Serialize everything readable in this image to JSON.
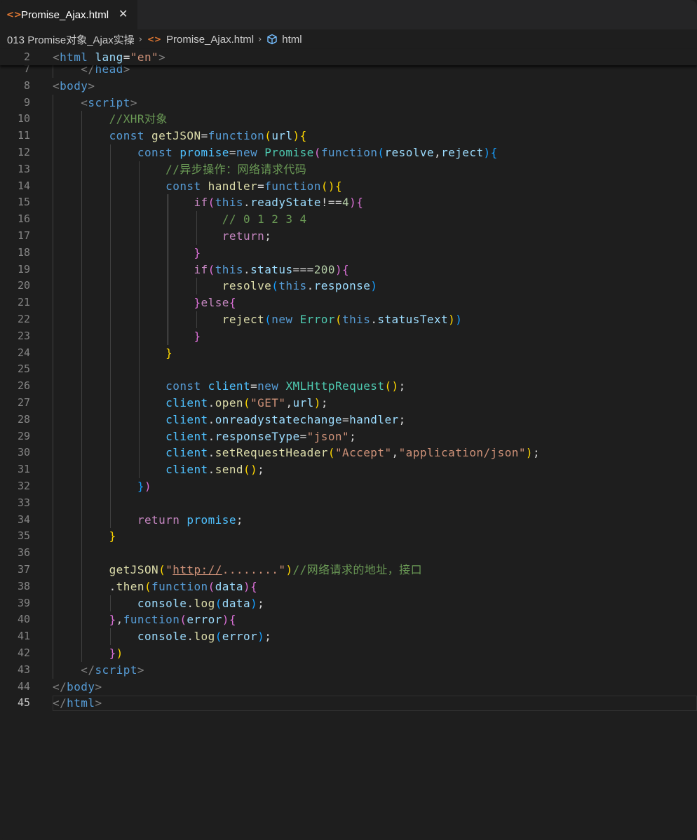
{
  "tab": {
    "icon": "html-code-icon",
    "label": "Promise_Ajax.html",
    "close": "✕"
  },
  "breadcrumb": {
    "folder": "013 Promise对象_Ajax实操",
    "file": "Promise_Ajax.html",
    "symbol": "html",
    "separator": "›"
  },
  "editor": {
    "active_line": "45",
    "sticky_line": {
      "number": "2",
      "tokens": [
        [
          "t-punc",
          "<"
        ],
        [
          "t-tag",
          "html"
        ],
        [
          "t-op",
          " "
        ],
        [
          "t-attr",
          "lang"
        ],
        [
          "t-op",
          "="
        ],
        [
          "t-str",
          "\"en\""
        ],
        [
          "t-punc",
          ">"
        ]
      ]
    },
    "lines": [
      {
        "n": "7",
        "tokens": [
          [
            "t-op",
            "    "
          ],
          [
            "t-punc",
            "</"
          ],
          [
            "t-tag",
            "head"
          ],
          [
            "t-punc",
            ">"
          ]
        ]
      },
      {
        "n": "8",
        "tokens": [
          [
            "t-punc",
            "<"
          ],
          [
            "t-tag",
            "body"
          ],
          [
            "t-punc",
            ">"
          ]
        ]
      },
      {
        "n": "9",
        "tokens": [
          [
            "t-op",
            "    "
          ],
          [
            "t-punc",
            "<"
          ],
          [
            "t-tag",
            "script"
          ],
          [
            "t-punc",
            ">"
          ]
        ]
      },
      {
        "n": "10",
        "tokens": [
          [
            "t-op",
            "        "
          ],
          [
            "t-com",
            "//XHR对象"
          ]
        ]
      },
      {
        "n": "11",
        "tokens": [
          [
            "t-op",
            "        "
          ],
          [
            "t-kw",
            "const"
          ],
          [
            "t-op",
            " "
          ],
          [
            "t-fn",
            "getJSON"
          ],
          [
            "t-op",
            "="
          ],
          [
            "t-kw",
            "function"
          ],
          [
            "b1",
            "("
          ],
          [
            "t-var",
            "url"
          ],
          [
            "b1",
            ")"
          ],
          [
            "b1",
            "{"
          ]
        ]
      },
      {
        "n": "12",
        "tokens": [
          [
            "t-op",
            "            "
          ],
          [
            "t-kw",
            "const"
          ],
          [
            "t-op",
            " "
          ],
          [
            "t-const",
            "promise"
          ],
          [
            "t-op",
            "="
          ],
          [
            "t-kw",
            "new"
          ],
          [
            "t-op",
            " "
          ],
          [
            "t-cls",
            "Promise"
          ],
          [
            "b2",
            "("
          ],
          [
            "t-kw",
            "function"
          ],
          [
            "b3",
            "("
          ],
          [
            "t-var",
            "resolve"
          ],
          [
            "t-op",
            ","
          ],
          [
            "t-var",
            "reject"
          ],
          [
            "b3",
            ")"
          ],
          [
            "b3",
            "{"
          ]
        ]
      },
      {
        "n": "13",
        "tokens": [
          [
            "t-op",
            "                "
          ],
          [
            "t-com",
            "//异步操作：网络请求代码"
          ]
        ]
      },
      {
        "n": "14",
        "tokens": [
          [
            "t-op",
            "                "
          ],
          [
            "t-kw",
            "const"
          ],
          [
            "t-op",
            " "
          ],
          [
            "t-fn",
            "handler"
          ],
          [
            "t-op",
            "="
          ],
          [
            "t-kw",
            "function"
          ],
          [
            "b1",
            "("
          ],
          [
            "b1",
            ")"
          ],
          [
            "b1",
            "{"
          ]
        ]
      },
      {
        "n": "15",
        "tokens": [
          [
            "t-op",
            "                    "
          ],
          [
            "t-ctl",
            "if"
          ],
          [
            "b2",
            "("
          ],
          [
            "t-kw",
            "this"
          ],
          [
            "t-op",
            "."
          ],
          [
            "t-var",
            "readyState"
          ],
          [
            "t-op",
            "!=="
          ],
          [
            "t-num",
            "4"
          ],
          [
            "b2",
            ")"
          ],
          [
            "b2",
            "{"
          ]
        ]
      },
      {
        "n": "16",
        "tokens": [
          [
            "t-op",
            "                        "
          ],
          [
            "t-com",
            "// 0 1 2 3 4"
          ]
        ]
      },
      {
        "n": "17",
        "tokens": [
          [
            "t-op",
            "                        "
          ],
          [
            "t-ctl",
            "return"
          ],
          [
            "t-op",
            ";"
          ]
        ]
      },
      {
        "n": "18",
        "tokens": [
          [
            "t-op",
            "                    "
          ],
          [
            "b2",
            "}"
          ]
        ]
      },
      {
        "n": "19",
        "tokens": [
          [
            "t-op",
            "                    "
          ],
          [
            "t-ctl",
            "if"
          ],
          [
            "b2",
            "("
          ],
          [
            "t-kw",
            "this"
          ],
          [
            "t-op",
            "."
          ],
          [
            "t-var",
            "status"
          ],
          [
            "t-op",
            "==="
          ],
          [
            "t-num",
            "200"
          ],
          [
            "b2",
            ")"
          ],
          [
            "b2",
            "{"
          ]
        ]
      },
      {
        "n": "20",
        "tokens": [
          [
            "t-op",
            "                        "
          ],
          [
            "t-fn",
            "resolve"
          ],
          [
            "b3",
            "("
          ],
          [
            "t-kw",
            "this"
          ],
          [
            "t-op",
            "."
          ],
          [
            "t-var",
            "response"
          ],
          [
            "b3",
            ")"
          ]
        ]
      },
      {
        "n": "21",
        "tokens": [
          [
            "t-op",
            "                    "
          ],
          [
            "b2",
            "}"
          ],
          [
            "t-ctl",
            "else"
          ],
          [
            "b2",
            "{"
          ]
        ]
      },
      {
        "n": "22",
        "tokens": [
          [
            "t-op",
            "                        "
          ],
          [
            "t-fn",
            "reject"
          ],
          [
            "b3",
            "("
          ],
          [
            "t-kw",
            "new"
          ],
          [
            "t-op",
            " "
          ],
          [
            "t-cls",
            "Error"
          ],
          [
            "b1",
            "("
          ],
          [
            "t-kw",
            "this"
          ],
          [
            "t-op",
            "."
          ],
          [
            "t-var",
            "statusText"
          ],
          [
            "b1",
            ")"
          ],
          [
            "b3",
            ")"
          ]
        ]
      },
      {
        "n": "23",
        "tokens": [
          [
            "t-op",
            "                    "
          ],
          [
            "b2",
            "}"
          ]
        ]
      },
      {
        "n": "24",
        "tokens": [
          [
            "t-op",
            "                "
          ],
          [
            "b1",
            "}"
          ]
        ]
      },
      {
        "n": "25",
        "tokens": []
      },
      {
        "n": "26",
        "tokens": [
          [
            "t-op",
            "                "
          ],
          [
            "t-kw",
            "const"
          ],
          [
            "t-op",
            " "
          ],
          [
            "t-const",
            "client"
          ],
          [
            "t-op",
            "="
          ],
          [
            "t-kw",
            "new"
          ],
          [
            "t-op",
            " "
          ],
          [
            "t-cls",
            "XMLHttpRequest"
          ],
          [
            "b1",
            "("
          ],
          [
            "b1",
            ")"
          ],
          [
            "t-op",
            ";"
          ]
        ]
      },
      {
        "n": "27",
        "tokens": [
          [
            "t-op",
            "                "
          ],
          [
            "t-const",
            "client"
          ],
          [
            "t-op",
            "."
          ],
          [
            "t-fn",
            "open"
          ],
          [
            "b1",
            "("
          ],
          [
            "t-str",
            "\"GET\""
          ],
          [
            "t-op",
            ","
          ],
          [
            "t-var",
            "url"
          ],
          [
            "b1",
            ")"
          ],
          [
            "t-op",
            ";"
          ]
        ]
      },
      {
        "n": "28",
        "tokens": [
          [
            "t-op",
            "                "
          ],
          [
            "t-const",
            "client"
          ],
          [
            "t-op",
            "."
          ],
          [
            "t-var",
            "onreadystatechange"
          ],
          [
            "t-op",
            "="
          ],
          [
            "t-var",
            "handler"
          ],
          [
            "t-op",
            ";"
          ]
        ]
      },
      {
        "n": "29",
        "tokens": [
          [
            "t-op",
            "                "
          ],
          [
            "t-const",
            "client"
          ],
          [
            "t-op",
            "."
          ],
          [
            "t-var",
            "responseType"
          ],
          [
            "t-op",
            "="
          ],
          [
            "t-str",
            "\"json\""
          ],
          [
            "t-op",
            ";"
          ]
        ]
      },
      {
        "n": "30",
        "tokens": [
          [
            "t-op",
            "                "
          ],
          [
            "t-const",
            "client"
          ],
          [
            "t-op",
            "."
          ],
          [
            "t-fn",
            "setRequestHeader"
          ],
          [
            "b1",
            "("
          ],
          [
            "t-str",
            "\"Accept\""
          ],
          [
            "t-op",
            ","
          ],
          [
            "t-str",
            "\"application/json\""
          ],
          [
            "b1",
            ")"
          ],
          [
            "t-op",
            ";"
          ]
        ]
      },
      {
        "n": "31",
        "tokens": [
          [
            "t-op",
            "                "
          ],
          [
            "t-const",
            "client"
          ],
          [
            "t-op",
            "."
          ],
          [
            "t-fn",
            "send"
          ],
          [
            "b1",
            "("
          ],
          [
            "b1",
            ")"
          ],
          [
            "t-op",
            ";"
          ]
        ]
      },
      {
        "n": "32",
        "tokens": [
          [
            "t-op",
            "            "
          ],
          [
            "b3",
            "}"
          ],
          [
            "b2",
            ")"
          ]
        ]
      },
      {
        "n": "33",
        "tokens": []
      },
      {
        "n": "34",
        "tokens": [
          [
            "t-op",
            "            "
          ],
          [
            "t-ctl",
            "return"
          ],
          [
            "t-op",
            " "
          ],
          [
            "t-const",
            "promise"
          ],
          [
            "t-op",
            ";"
          ]
        ]
      },
      {
        "n": "35",
        "tokens": [
          [
            "t-op",
            "        "
          ],
          [
            "b1",
            "}"
          ]
        ]
      },
      {
        "n": "36",
        "tokens": []
      },
      {
        "n": "37",
        "tokens": [
          [
            "t-op",
            "        "
          ],
          [
            "t-fn",
            "getJSON"
          ],
          [
            "b1",
            "("
          ],
          [
            "t-str",
            "\""
          ],
          [
            "t-str t-link",
            "http://"
          ],
          [
            "t-str",
            "........\""
          ],
          [
            "b1",
            ")"
          ],
          [
            "t-com",
            "//网络请求的地址，接口"
          ]
        ]
      },
      {
        "n": "38",
        "tokens": [
          [
            "t-op",
            "        ."
          ],
          [
            "t-fn",
            "then"
          ],
          [
            "b1",
            "("
          ],
          [
            "t-kw",
            "function"
          ],
          [
            "b2",
            "("
          ],
          [
            "t-var",
            "data"
          ],
          [
            "b2",
            ")"
          ],
          [
            "b2",
            "{"
          ]
        ]
      },
      {
        "n": "39",
        "tokens": [
          [
            "t-op",
            "            "
          ],
          [
            "t-var",
            "console"
          ],
          [
            "t-op",
            "."
          ],
          [
            "t-fn",
            "log"
          ],
          [
            "b3",
            "("
          ],
          [
            "t-var",
            "data"
          ],
          [
            "b3",
            ")"
          ],
          [
            "t-op",
            ";"
          ]
        ]
      },
      {
        "n": "40",
        "tokens": [
          [
            "t-op",
            "        "
          ],
          [
            "b2",
            "}"
          ],
          [
            "t-op",
            ","
          ],
          [
            "t-kw",
            "function"
          ],
          [
            "b2",
            "("
          ],
          [
            "t-var",
            "error"
          ],
          [
            "b2",
            ")"
          ],
          [
            "b2",
            "{"
          ]
        ]
      },
      {
        "n": "41",
        "tokens": [
          [
            "t-op",
            "            "
          ],
          [
            "t-var",
            "console"
          ],
          [
            "t-op",
            "."
          ],
          [
            "t-fn",
            "log"
          ],
          [
            "b3",
            "("
          ],
          [
            "t-var",
            "error"
          ],
          [
            "b3",
            ")"
          ],
          [
            "t-op",
            ";"
          ]
        ]
      },
      {
        "n": "42",
        "tokens": [
          [
            "t-op",
            "        "
          ],
          [
            "b2",
            "}"
          ],
          [
            "b1",
            ")"
          ]
        ]
      },
      {
        "n": "43",
        "tokens": [
          [
            "t-op",
            "    "
          ],
          [
            "t-punc",
            "</"
          ],
          [
            "t-tag",
            "script"
          ],
          [
            "t-punc",
            ">"
          ]
        ]
      },
      {
        "n": "44",
        "tokens": [
          [
            "t-punc",
            "</"
          ],
          [
            "t-tag",
            "body"
          ],
          [
            "t-punc",
            ">"
          ]
        ]
      },
      {
        "n": "45",
        "tokens": [
          [
            "t-punc",
            "</"
          ],
          [
            "t-tag",
            "html"
          ],
          [
            "t-punc",
            ">"
          ]
        ]
      }
    ]
  },
  "colors": {
    "background": "#1e1e1e",
    "tab_icon": "#e37933",
    "symbol_icon": "#75beff"
  }
}
